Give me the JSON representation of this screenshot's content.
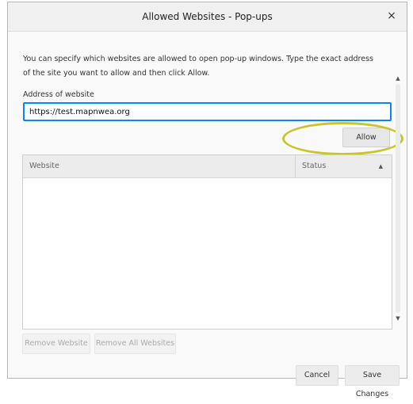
{
  "dialog": {
    "title": "Allowed Websites - Pop-ups",
    "close_glyph": "×"
  },
  "description": "You can specify which websites are allowed to open pop-up windows. Type the exact address of the site you want to allow and then click Allow.",
  "address": {
    "label": "Address of website",
    "value": "https://test.mapnwea.org"
  },
  "allow_button": "Allow",
  "table": {
    "columns": [
      "Website",
      "Status"
    ],
    "sort_glyph": "▲",
    "rows": []
  },
  "scrollbar": {
    "up": "▲",
    "down": "▼"
  },
  "buttons": {
    "remove": "Remove Website",
    "remove_all": "Remove All Websites",
    "cancel": "Cancel",
    "save": "Save Changes"
  },
  "highlight_color": "#c8c430",
  "accent_color": "#0a84ff"
}
